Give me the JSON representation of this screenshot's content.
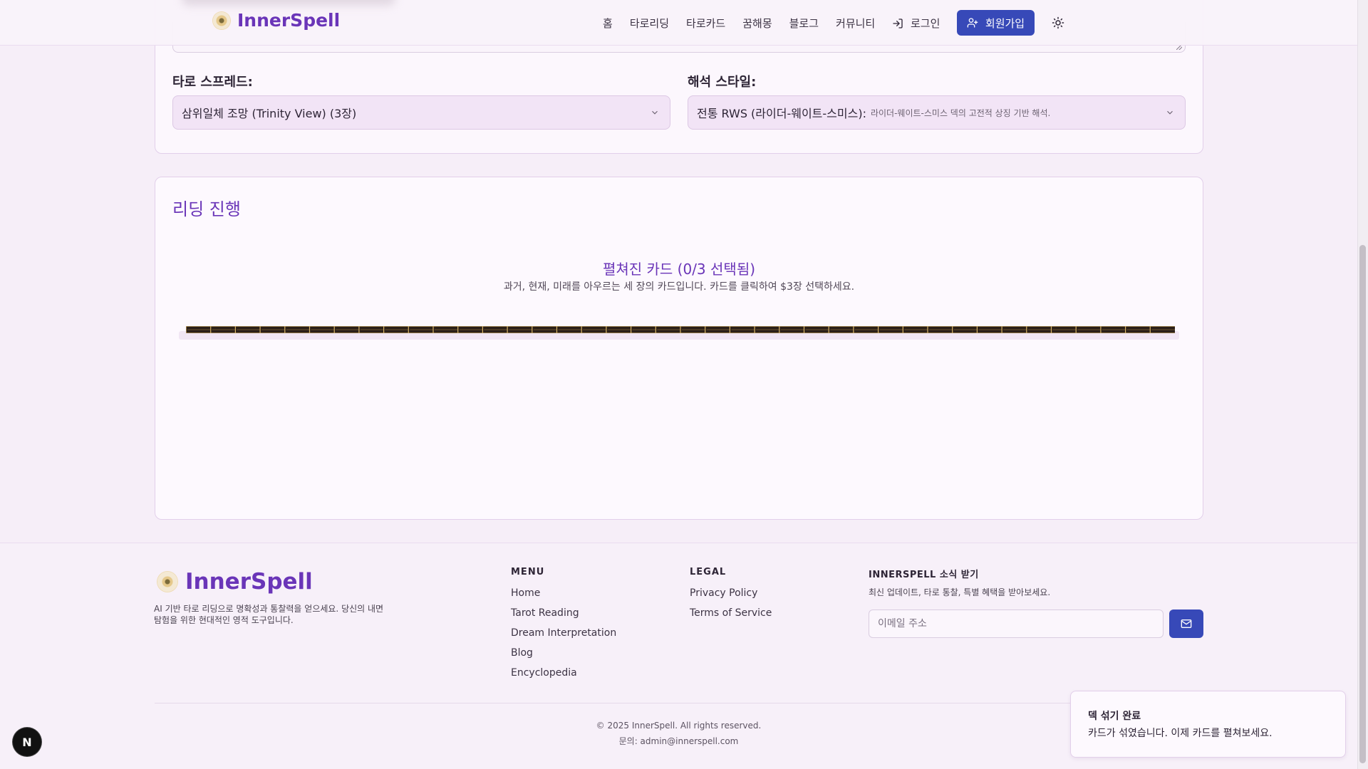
{
  "header": {
    "brand": "InnerSpell",
    "nav": [
      "홈",
      "타로리딩",
      "타로카드",
      "꿈해몽",
      "블로그",
      "커뮤니티"
    ],
    "login_label": "로그인",
    "signup_label": "회원가입"
  },
  "settings": {
    "spread_label": "타로 스프레드:",
    "spread_value": "삼위일체 조망 (Trinity View) (3장)",
    "style_label": "해석 스타일:",
    "style_value": "전통 RWS (라이더-웨이트-스미스):",
    "style_hint": "라이더-웨이트-스미스 덱의 고전적 상징 기반 해석."
  },
  "reading": {
    "title": "리딩 진행",
    "spread_title": "펼쳐진 카드 (0/3 선택됨)",
    "spread_subtitle": "과거, 현재, 미래를 아우르는 세 장의 카드입니다. 카드를 클릭하여 $3장 선택하세요."
  },
  "footer": {
    "brand": "InnerSpell",
    "description": "AI 기반 타로 리딩으로 명확성과 통찰력을 얻으세요. 당신의 내면 탐험을 위한 현대적인 영적 도구입니다.",
    "menu_heading": "MENU",
    "menu_links": [
      "Home",
      "Tarot Reading",
      "Dream Interpretation",
      "Blog",
      "Encyclopedia"
    ],
    "legal_heading": "LEGAL",
    "legal_links": [
      "Privacy Policy",
      "Terms of Service"
    ],
    "newsletter_heading": "INNERSPELL 소식 받기",
    "newsletter_note": "최신 업데이트, 타로 통찰, 특별 혜택을 받아보세요.",
    "email_placeholder": "이메일 주소",
    "copyright": "© 2025 InnerSpell. All rights reserved.",
    "contact": "문의: admin@innerspell.com"
  },
  "toast": {
    "title": "덱 섞기 완료",
    "description": "카드가 섞였습니다. 이제 카드를 펼쳐보세요."
  },
  "dev_badge": "N",
  "colors": {
    "accent": "#6a35b8",
    "button": "#3749b8",
    "background": "#f6eef8"
  }
}
